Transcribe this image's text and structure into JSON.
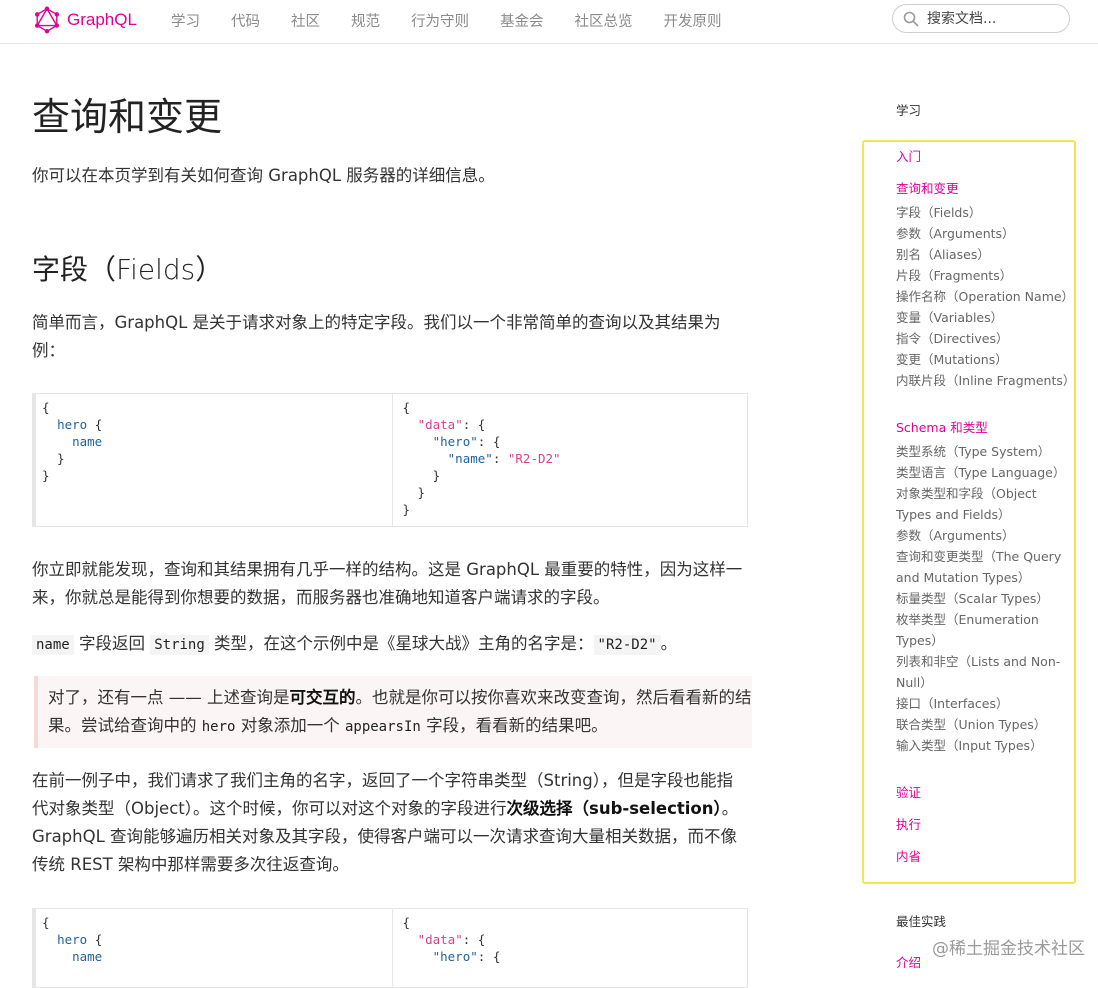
{
  "header": {
    "brand": "GraphQL",
    "nav": [
      "学习",
      "代码",
      "社区",
      "规范",
      "行为守则",
      "基金会",
      "社区总览",
      "开发原则"
    ],
    "search_placeholder": "搜索文档..."
  },
  "main": {
    "title": "查询和变更",
    "intro": "你可以在本页学到有关如何查询 GraphQL 服务器的详细信息。",
    "section_title": "字段（Fields）",
    "p1": "简单而言，GraphQL 是关于请求对象上的特定字段。我们以一个非常简单的查询以及其结果为例：",
    "p2": "你立即就能发现，查询和其结果拥有几乎一样的结构。这是 GraphQL 最重要的特性，因为这样一来，你就总是能得到你想要的数据，而服务器也准确地知道客户端请求的字段。",
    "p3": {
      "code1": "name",
      "t1": " 字段返回 ",
      "code2": "String",
      "t2": " 类型，在这个示例中是《星球大战》主角的名字是：",
      "code3": "\"R2-D2\"",
      "t3": "。"
    },
    "note": {
      "t1": "对了，还有一点 —— 上述查询是",
      "bold": "可交互的",
      "t2": "。也就是你可以按你喜欢来改变查询，然后看看新的结果。尝试给查询中的 ",
      "code1": "hero",
      "t3": " 对象添加一个 ",
      "code2": "appearsIn",
      "t4": " 字段，看看新的结果吧。"
    },
    "p5": {
      "t1": "在前一例子中，我们请求了我们主角的名字，返回了一个字符串类型（String），但是字段也能指代对象类型（Object）。这个时候，你可以对这个对象的字段进行",
      "bold": "次级选择（sub-selection）",
      "t2": "。GraphQL 查询能够遍历相关对象及其字段，使得客户端可以一次请求查询大量相关数据，而不像传统 REST 架构中那样需要多次往返查询。"
    },
    "code1": {
      "query": [
        "{",
        "  hero {",
        "    name",
        "  }",
        "}"
      ],
      "result": [
        "{",
        "  \"data\": {",
        "    \"hero\": {",
        "      \"name\": \"R2-D2\"",
        "    }",
        "  }",
        "}"
      ]
    },
    "code2": {
      "query": [
        "{",
        "  hero {",
        "    name"
      ],
      "result": [
        "{",
        "  \"data\": {",
        "    \"hero\": {"
      ]
    }
  },
  "sidebar": {
    "section1": "学习",
    "links_top": [
      "入门",
      "查询和变更"
    ],
    "query_items": [
      "字段（Fields）",
      "参数（Arguments）",
      "别名（Aliases）",
      "片段（Fragments）",
      "操作名称（Operation Name）",
      "变量（Variables）",
      "指令（Directives）",
      "变更（Mutations）",
      "内联片段（Inline Fragments）"
    ],
    "schema_link": "Schema 和类型",
    "schema_items": [
      "类型系统（Type System）",
      "类型语言（Type Language）",
      "对象类型和字段（Object",
      "Types and Fields）",
      "参数（Arguments）",
      "查询和变更类型（The Query",
      "and Mutation Types）",
      "标量类型（Scalar Types）",
      "枚举类型（Enumeration",
      "Types）",
      "列表和非空（Lists and Non-",
      "Null）",
      "接口（Interfaces）",
      "联合类型（Union Types）",
      "输入类型（Input Types）"
    ],
    "links_bottom": [
      "验证",
      "执行",
      "内省"
    ],
    "section2": "最佳实践",
    "cut_link": "介绍"
  },
  "watermark": "@稀土掘金技术社区",
  "colors": {
    "brand": "#e10098",
    "highlight_box": "#f2e64f"
  }
}
